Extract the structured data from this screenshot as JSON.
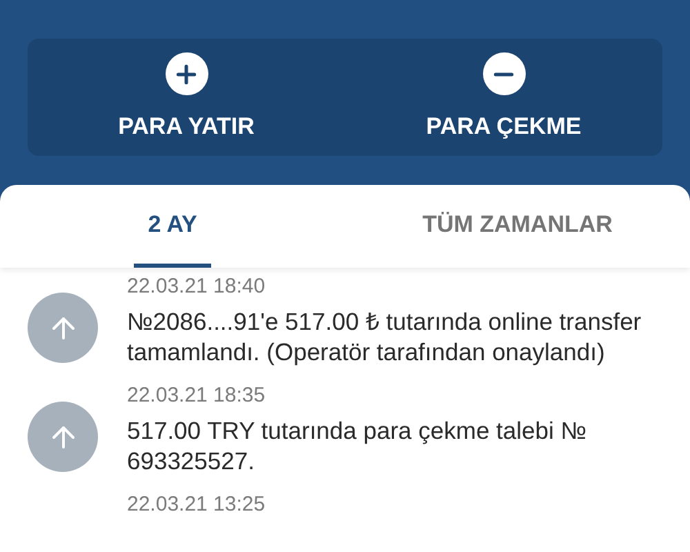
{
  "actions": [
    {
      "kind": "plus",
      "label": "PARA YATIR"
    },
    {
      "kind": "minus",
      "label": "PARA ÇEKME"
    }
  ],
  "tabs": [
    {
      "label": "2 AY",
      "selected": true
    },
    {
      "label": "TÜM ZAMANLAR",
      "selected": false
    }
  ],
  "transactions": [
    {
      "date": "22.03.21 18:40",
      "text": "№2086....91'e 517.00 ₺ tutarında online transfer tamamlandı. (Operatör tarafından onaylandı)"
    },
    {
      "date": "22.03.21 18:35",
      "text": "517.00 TRY tutarında para çekme talebi № 693325527."
    },
    {
      "date": "22.03.21 13:25"
    }
  ]
}
